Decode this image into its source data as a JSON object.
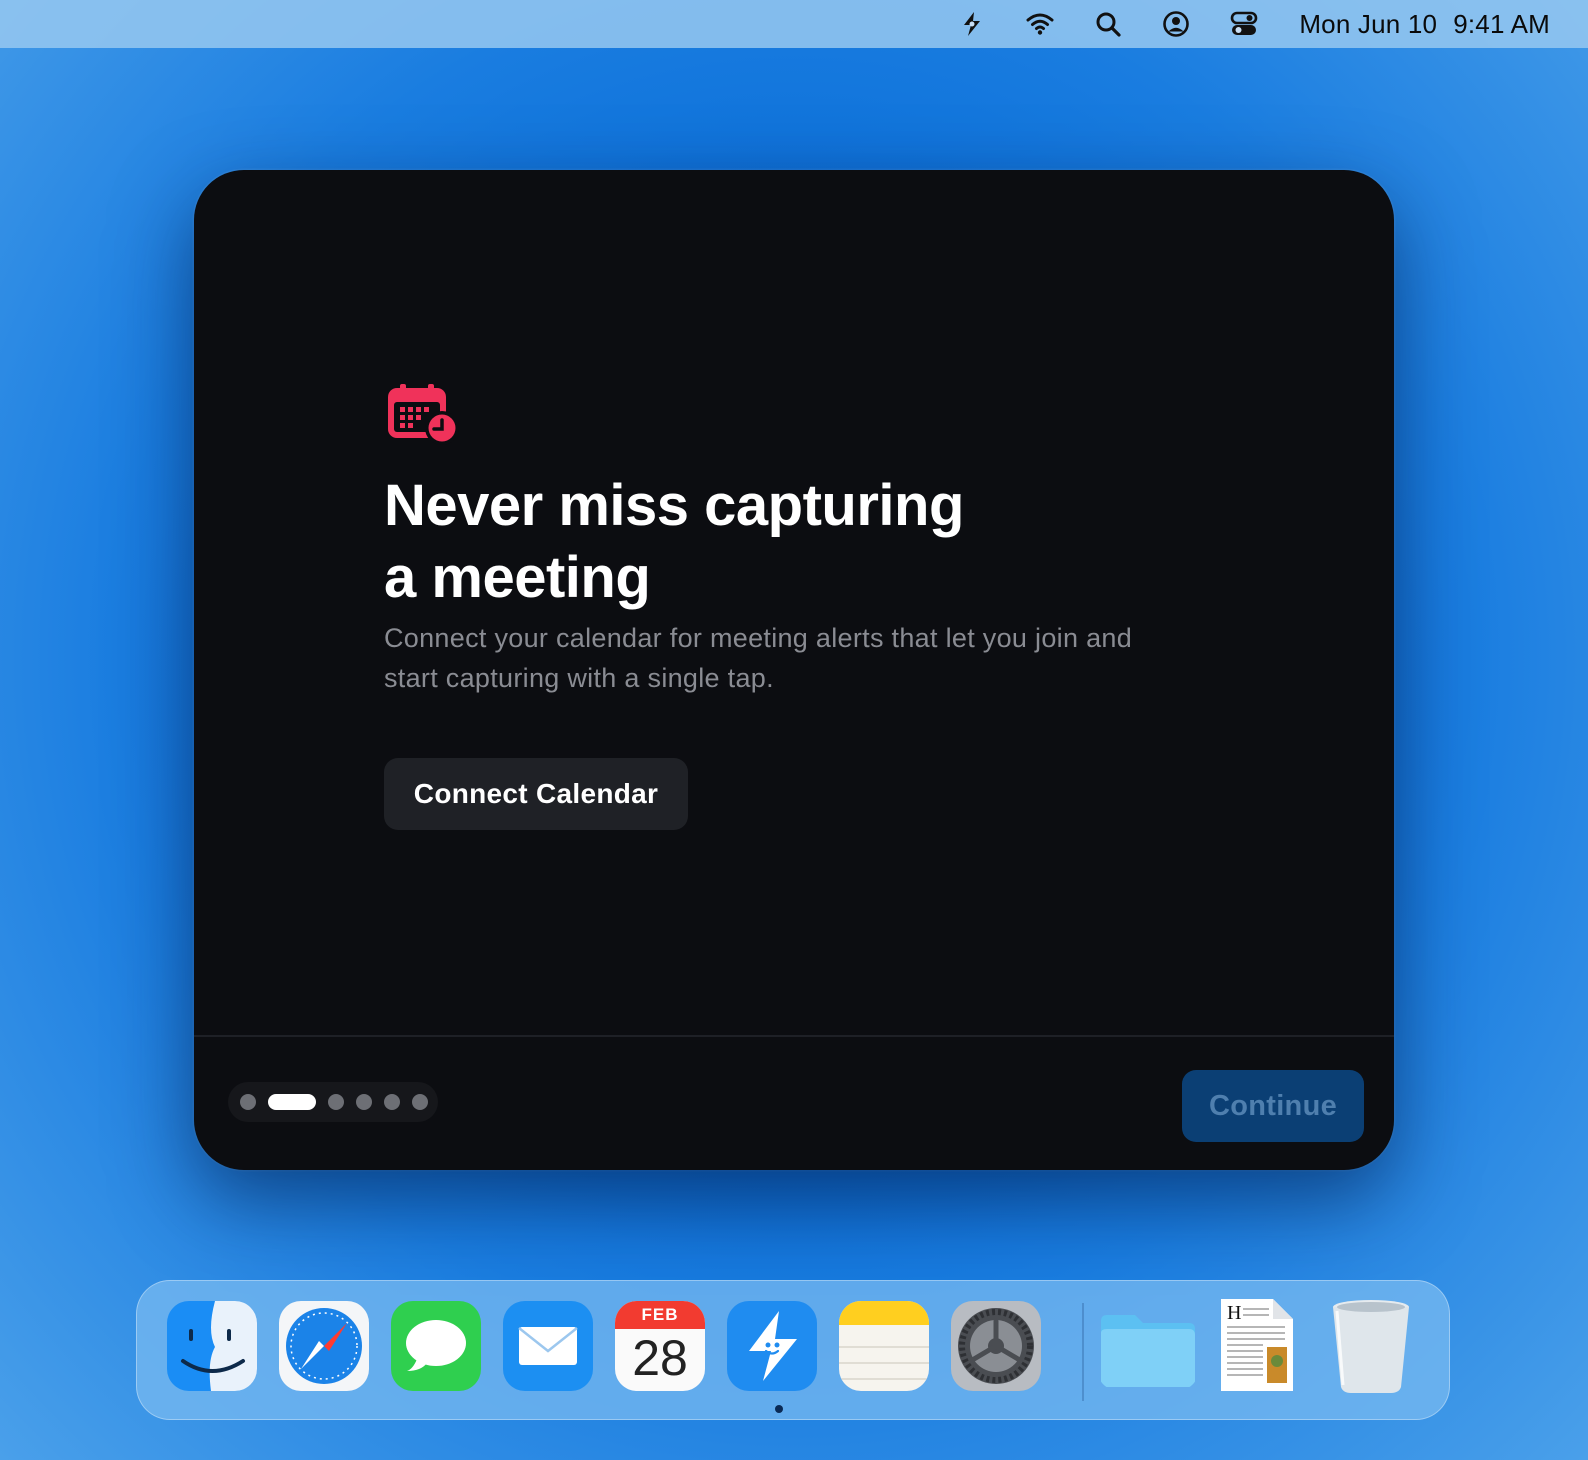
{
  "menubar": {
    "icons": [
      "app-bolt-icon",
      "wifi-icon",
      "search-icon",
      "user-account-icon",
      "control-center-icon"
    ],
    "date": "Mon Jun 10",
    "time": "9:41 AM"
  },
  "onboarding": {
    "icon": "calendar-clock-icon",
    "accent_color": "#f0325a",
    "headline_line1": "Never miss capturing",
    "headline_line2": "a meeting",
    "description_line1": "Connect your calendar for meeting alerts that let you join and",
    "description_line2": "start capturing with a single tap.",
    "connect_button": "Connect Calendar",
    "continue_button": "Continue",
    "pager": {
      "total_pages": 6,
      "current_page": 2
    }
  },
  "dock": {
    "apps": [
      {
        "name": "Finder",
        "icon": "finder-icon"
      },
      {
        "name": "Safari",
        "icon": "safari-icon"
      },
      {
        "name": "Messages",
        "icon": "messages-icon"
      },
      {
        "name": "Mail",
        "icon": "mail-icon"
      },
      {
        "name": "Calendar",
        "icon": "calendar-icon",
        "month": "FEB",
        "day": "28"
      },
      {
        "name": "App",
        "icon": "bolt-app-icon",
        "running": true
      },
      {
        "name": "Notes",
        "icon": "notes-icon"
      },
      {
        "name": "System Settings",
        "icon": "settings-gear-icon"
      }
    ],
    "others": [
      {
        "name": "Folder",
        "icon": "folder-icon"
      },
      {
        "name": "Document",
        "icon": "document-icon"
      },
      {
        "name": "Trash",
        "icon": "trash-icon"
      }
    ]
  }
}
